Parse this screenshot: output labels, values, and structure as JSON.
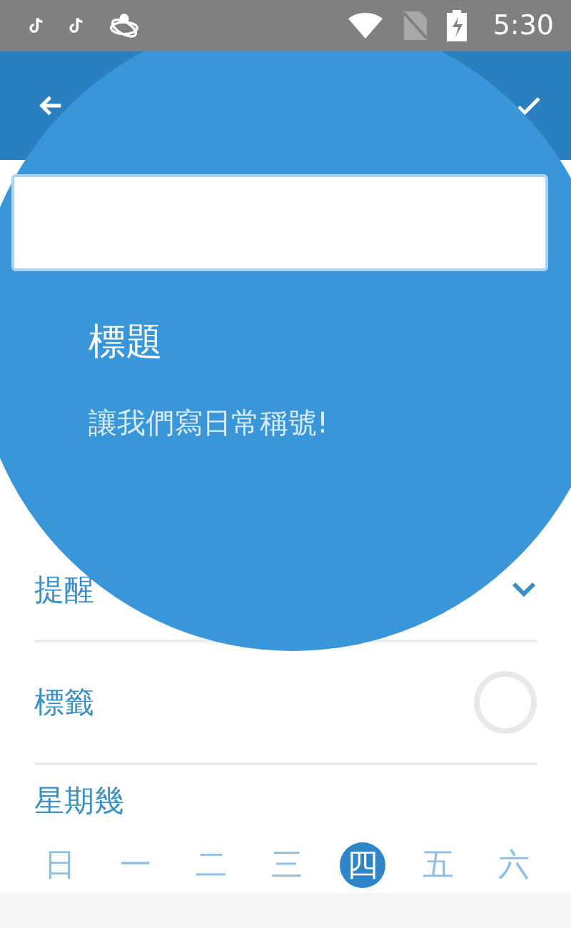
{
  "status_bar": {
    "time": "5:30"
  },
  "header": {
    "title": "標題",
    "subtitle": "讓我們寫日常稱號!"
  },
  "settings": [
    {
      "kind": "dropdown",
      "label": "提醒"
    },
    {
      "kind": "toggle",
      "label": "標籤",
      "on": false
    },
    {
      "kind": "plain",
      "label": "星期幾"
    }
  ],
  "weekdays": [
    {
      "label": "日",
      "selected": false
    },
    {
      "label": "一",
      "selected": false
    },
    {
      "label": "二",
      "selected": false
    },
    {
      "label": "三",
      "selected": false
    },
    {
      "label": "四",
      "selected": true
    },
    {
      "label": "五",
      "selected": false
    },
    {
      "label": "六",
      "selected": false
    }
  ]
}
